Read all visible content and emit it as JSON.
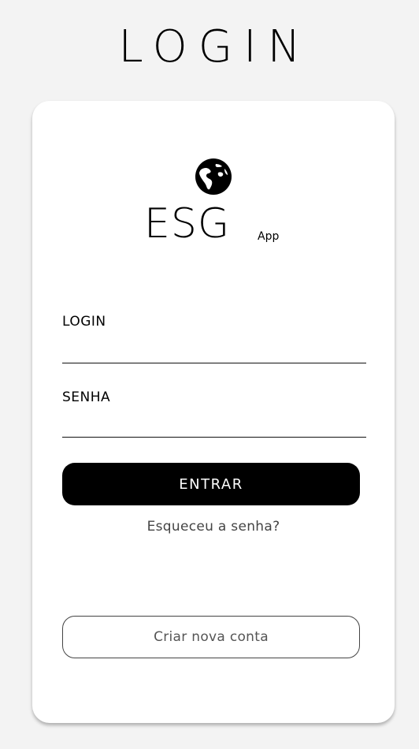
{
  "header": {
    "title": "LOGIN"
  },
  "brand": {
    "name": "ESG",
    "suffix": "App",
    "icon": "globe-icon"
  },
  "form": {
    "login_label": "LOGIN",
    "login_value": "",
    "password_label": "SENHA",
    "password_value": "",
    "submit_label": "ENTRAR",
    "forgot_label": "Esqueceu a senha?",
    "create_account_label": "Criar nova conta"
  },
  "colors": {
    "background": "#f3f3f3",
    "card": "#ffffff",
    "primary_button": "#000000",
    "primary_button_text": "#ffffff",
    "muted_text": "#444444"
  }
}
